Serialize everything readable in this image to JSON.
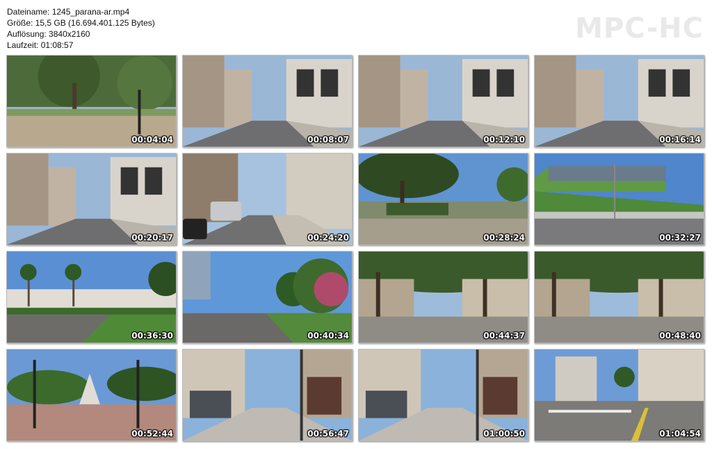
{
  "info": {
    "filename": "Dateiname: 1245_parana-ar.mp4",
    "size": "Größe: 15,5 GB (16.694.401.125 Bytes)",
    "resolution": "Auflösung: 3840x2160",
    "duration": "Laufzeit: 01:08:57"
  },
  "logo": "MPC-HC",
  "thumbnails": [
    {
      "time": "00:04:04",
      "scene": "park-path"
    },
    {
      "time": "00:08:07",
      "scene": "street-buildings"
    },
    {
      "time": "00:12:10",
      "scene": "street-buildings"
    },
    {
      "time": "00:16:14",
      "scene": "street-buildings"
    },
    {
      "time": "00:20:17",
      "scene": "street-buildings"
    },
    {
      "time": "00:24:20",
      "scene": "street-cars"
    },
    {
      "time": "00:28:24",
      "scene": "tree-sky"
    },
    {
      "time": "00:32:27",
      "scene": "green-hill"
    },
    {
      "time": "00:36:30",
      "scene": "palms-road"
    },
    {
      "time": "00:40:34",
      "scene": "trees-road"
    },
    {
      "time": "00:44:37",
      "scene": "tree-avenue"
    },
    {
      "time": "00:48:40",
      "scene": "tree-avenue"
    },
    {
      "time": "00:52:44",
      "scene": "plaza-fountain"
    },
    {
      "time": "00:56:47",
      "scene": "pedestrian-street"
    },
    {
      "time": "01:00:50",
      "scene": "pedestrian-street"
    },
    {
      "time": "01:04:54",
      "scene": "intersection"
    }
  ]
}
